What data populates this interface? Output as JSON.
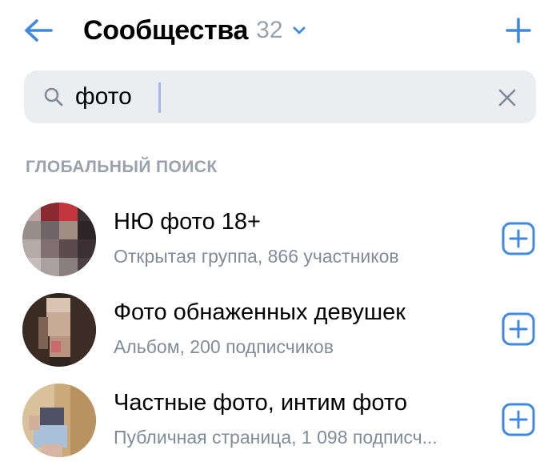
{
  "header": {
    "title": "Сообщества",
    "count": "32",
    "back_icon": "arrow-left-icon",
    "dropdown_icon": "chevron-down-icon",
    "add_icon": "plus-icon"
  },
  "search": {
    "value": "фото",
    "search_icon": "search-icon",
    "clear_icon": "close-icon"
  },
  "section": {
    "title": "ГЛОБАЛЬНЫЙ ПОИСК"
  },
  "results": [
    {
      "name": "НЮ фото 18+",
      "subtitle": "Открытая группа, 866 участников",
      "action_icon": "plus-square-icon"
    },
    {
      "name": "Фото обнаженных девушек",
      "subtitle": "Альбом, 200 подписчиков",
      "action_icon": "plus-square-icon"
    },
    {
      "name": "Частные фото, интим фото",
      "subtitle": "Публичная страница, 1 098 подписч...",
      "action_icon": "plus-square-icon"
    }
  ],
  "colors": {
    "accent": "#3f8ae0",
    "secondary_text": "#818c99",
    "search_bg": "#ebedf0",
    "count_text": "#99a2ad"
  }
}
